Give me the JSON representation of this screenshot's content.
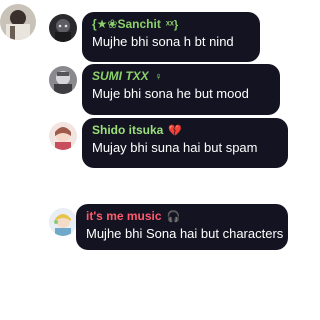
{
  "messages": [
    {
      "name": "{★❀Sanchit",
      "name_suffix": "ˣˣ}",
      "text": "Mujhe bhi sona h bt nind",
      "name_color": "#8bd16a"
    },
    {
      "name": "SUMI TХХ",
      "name_suffix": "♀",
      "text": "Muje bhi sona he but mood",
      "name_color": "#8bd16a"
    },
    {
      "name": "Shido itsuka",
      "name_suffix": "💔",
      "text": "Mujay bhi suna hai but spam",
      "name_color": "#9be07a"
    },
    {
      "name": "it's me music",
      "name_suffix": "🎧",
      "text": "Mujhe bhi Sona hai but characters",
      "name_color": "#ff5a6e"
    }
  ],
  "icons": {
    "avatar_self": "anime-avatar",
    "avatar_1": "anime-avatar",
    "avatar_2": "anime-avatar",
    "avatar_3": "anime-avatar",
    "avatar_4": "anime-avatar"
  }
}
